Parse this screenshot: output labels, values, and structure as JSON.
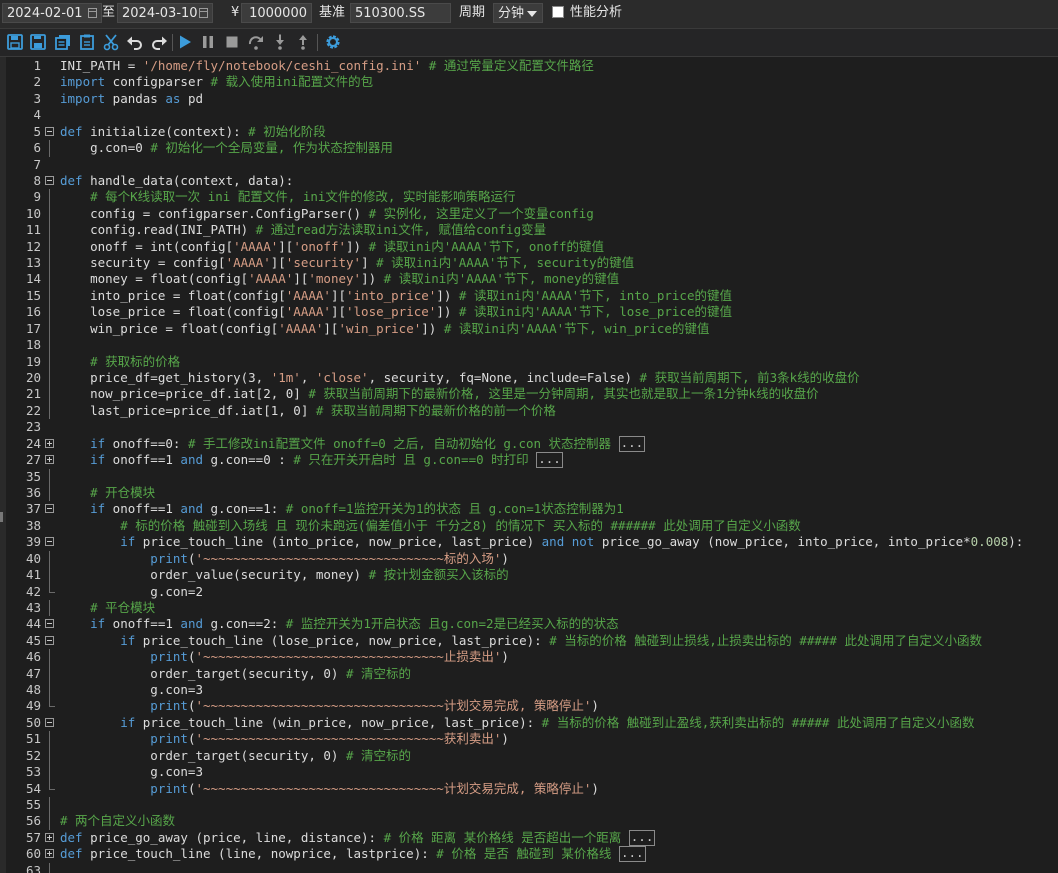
{
  "topbar": {
    "start_date": "2024-02-01",
    "to_label": "至",
    "end_date": "2024-03-10",
    "currency_symbol": "¥",
    "capital": "1000000",
    "benchmark_label": "基准",
    "benchmark": "510300.SS",
    "period_label": "周期",
    "period_value": "分钟",
    "perf_label": "性能分析",
    "perf_checked": false
  },
  "toolbar": {
    "buttons": [
      "save-icon",
      "save-as-icon",
      "copy-icon",
      "paste-icon",
      "cut-icon",
      "undo-icon",
      "redo-icon",
      "run-icon",
      "pause-icon",
      "stop-icon",
      "step-over-icon",
      "step-into-icon",
      "step-out-icon",
      "settings-icon"
    ],
    "accent_color": "#3c9cdb"
  },
  "editor": {
    "lines": [
      {
        "n": "1",
        "code": [
          [
            "",
            "INI_PATH = "
          ],
          [
            "str",
            "'/home/fly/notebook/ceshi_config.ini'"
          ],
          [
            "cm",
            " # 通过常量定义配置文件路径"
          ]
        ]
      },
      {
        "n": "2",
        "code": [
          [
            "kw",
            "import"
          ],
          [
            "",
            " configparser "
          ],
          [
            "cm",
            "# 载入使用ini配置文件的包"
          ]
        ]
      },
      {
        "n": "3",
        "code": [
          [
            "kw",
            "import"
          ],
          [
            "",
            " pandas "
          ],
          [
            "kw",
            "as"
          ],
          [
            "",
            " pd"
          ]
        ]
      },
      {
        "n": "4",
        "code": []
      },
      {
        "n": "5",
        "fold": "minus",
        "code": [
          [
            "kw",
            "def"
          ],
          [
            "",
            " initialize(context): "
          ],
          [
            "cm",
            "# 初始化阶段"
          ]
        ]
      },
      {
        "n": "6",
        "code": [
          [
            "",
            "    g.con=0 "
          ],
          [
            "cm",
            "# 初始化一个全局变量, 作为状态控制器用"
          ]
        ]
      },
      {
        "n": "7",
        "code": []
      },
      {
        "n": "8",
        "fold": "minus",
        "code": [
          [
            "kw",
            "def"
          ],
          [
            "",
            " handle_data(context, data):"
          ]
        ]
      },
      {
        "n": "9",
        "code": [
          [
            "cm",
            "    # 每个K线读取一次 ini 配置文件, ini文件的修改, 实时能影响策略运行"
          ]
        ]
      },
      {
        "n": "10",
        "code": [
          [
            "",
            "    config = configparser.ConfigParser() "
          ],
          [
            "cm",
            "# 实例化, 这里定义了一个变量config"
          ]
        ]
      },
      {
        "n": "11",
        "code": [
          [
            "",
            "    config.read(INI_PATH) "
          ],
          [
            "cm",
            "# 通过read方法读取ini文件, 赋值给config变量"
          ]
        ]
      },
      {
        "n": "12",
        "code": [
          [
            "",
            "    onoff = int(config["
          ],
          [
            "str",
            "'AAAA'"
          ],
          [
            "",
            "]["
          ],
          [
            "str",
            "'onoff'"
          ],
          [
            "",
            "]) "
          ],
          [
            "cm",
            "# 读取ini内'AAAA'节下, onoff的键值"
          ]
        ]
      },
      {
        "n": "13",
        "code": [
          [
            "",
            "    security = config["
          ],
          [
            "str",
            "'AAAA'"
          ],
          [
            "",
            "]["
          ],
          [
            "str",
            "'security'"
          ],
          [
            "",
            "] "
          ],
          [
            "cm",
            "# 读取ini内'AAAA'节下, security的键值"
          ]
        ]
      },
      {
        "n": "14",
        "code": [
          [
            "",
            "    money = float(config["
          ],
          [
            "str",
            "'AAAA'"
          ],
          [
            "",
            "]["
          ],
          [
            "str",
            "'money'"
          ],
          [
            "",
            "]) "
          ],
          [
            "cm",
            "# 读取ini内'AAAA'节下, money的键值"
          ]
        ]
      },
      {
        "n": "15",
        "code": [
          [
            "",
            "    into_price = float(config["
          ],
          [
            "str",
            "'AAAA'"
          ],
          [
            "",
            "]["
          ],
          [
            "str",
            "'into_price'"
          ],
          [
            "",
            "]) "
          ],
          [
            "cm",
            "# 读取ini内'AAAA'节下, into_price的键值"
          ]
        ]
      },
      {
        "n": "16",
        "code": [
          [
            "",
            "    lose_price = float(config["
          ],
          [
            "str",
            "'AAAA'"
          ],
          [
            "",
            "]["
          ],
          [
            "str",
            "'lose_price'"
          ],
          [
            "",
            "]) "
          ],
          [
            "cm",
            "# 读取ini内'AAAA'节下, lose_price的键值"
          ]
        ]
      },
      {
        "n": "17",
        "code": [
          [
            "",
            "    win_price = float(config["
          ],
          [
            "str",
            "'AAAA'"
          ],
          [
            "",
            "]["
          ],
          [
            "str",
            "'win_price'"
          ],
          [
            "",
            "]) "
          ],
          [
            "cm",
            "# 读取ini内'AAAA'节下, win_price的键值"
          ]
        ]
      },
      {
        "n": "18",
        "code": []
      },
      {
        "n": "19",
        "code": [
          [
            "cm",
            "    # 获取标的价格"
          ]
        ]
      },
      {
        "n": "20",
        "code": [
          [
            "",
            "    price_df=get_history(3, "
          ],
          [
            "str",
            "'1m'"
          ],
          [
            "",
            ", "
          ],
          [
            "str",
            "'close'"
          ],
          [
            "",
            ", security, fq=None, include=False) "
          ],
          [
            "cm",
            "# 获取当前周期下, 前3条k线的收盘价"
          ]
        ]
      },
      {
        "n": "21",
        "code": [
          [
            "",
            "    now_price=price_df.iat[2, 0] "
          ],
          [
            "cm",
            "# 获取当前周期下的最新价格, 这里是一分钟周期, 其实也就是取上一条1分钟k线的收盘价"
          ]
        ]
      },
      {
        "n": "22",
        "code": [
          [
            "",
            "    last_price=price_df.iat[1, 0] "
          ],
          [
            "cm",
            "# 获取当前周期下的最新价格的前一个价格"
          ]
        ]
      },
      {
        "n": "23",
        "code": []
      },
      {
        "n": "24",
        "fold": "plus",
        "code": [
          [
            "kw",
            "    if"
          ],
          [
            "",
            " onoff==0: "
          ],
          [
            "cm",
            "# 手工修改ini配置文件 onoff=0 之后, 自动初始化 g.con 状态控制器 "
          ],
          [
            "ell",
            "..."
          ]
        ]
      },
      {
        "n": "27",
        "fold": "plus",
        "code": [
          [
            "kw",
            "    if"
          ],
          [
            "",
            " onoff==1 "
          ],
          [
            "kw",
            "and"
          ],
          [
            "",
            " g.con==0 : "
          ],
          [
            "cm",
            "# 只在开关开启时 且 g.con==0 时打印 "
          ],
          [
            "ell",
            "..."
          ]
        ]
      },
      {
        "n": "35",
        "code": []
      },
      {
        "n": "36",
        "code": [
          [
            "cm",
            "    # 开仓模块"
          ]
        ]
      },
      {
        "n": "37",
        "fold": "minus",
        "code": [
          [
            "kw",
            "    if"
          ],
          [
            "",
            " onoff==1 "
          ],
          [
            "kw",
            "and"
          ],
          [
            "",
            " g.con==1: "
          ],
          [
            "cm",
            "# onoff=1监控开关为1的状态 且 g.con=1状态控制器为1"
          ]
        ]
      },
      {
        "n": "38",
        "code": [
          [
            "cm",
            "        # 标的价格 触碰到入场线 且 现价未跑远(偏差值小于 千分之8) 的情况下 买入标的 ###### 此处调用了自定义小函数"
          ]
        ]
      },
      {
        "n": "39",
        "fold": "minus",
        "code": [
          [
            "kw",
            "        if"
          ],
          [
            "",
            " price_touch_line (into_price, now_price, last_price) "
          ],
          [
            "kw",
            "and not"
          ],
          [
            "",
            " price_go_away (now_price, into_price, into_price*"
          ],
          [
            "nm",
            "0.008"
          ],
          [
            "",
            "):"
          ]
        ]
      },
      {
        "n": "40",
        "code": [
          [
            "kw",
            "            print"
          ],
          [
            "",
            "("
          ],
          [
            "str",
            "'~~~~~~~~~~~~~~~~~~~~~~~~~~~~~~~~标的入场'"
          ],
          [
            "",
            ")"
          ]
        ]
      },
      {
        "n": "41",
        "code": [
          [
            "",
            "            order_value(security, money) "
          ],
          [
            "cm",
            "# 按计划金额买入该标的"
          ]
        ]
      },
      {
        "n": "42",
        "end": true,
        "code": [
          [
            "",
            "            g.con=2"
          ]
        ]
      },
      {
        "n": "43",
        "code": [
          [
            "cm",
            "    # 平仓模块"
          ]
        ]
      },
      {
        "n": "44",
        "fold": "minus",
        "code": [
          [
            "kw",
            "    if"
          ],
          [
            "",
            " onoff==1 "
          ],
          [
            "kw",
            "and"
          ],
          [
            "",
            " g.con==2: "
          ],
          [
            "cm",
            "# 监控开关为1开启状态 且g.con=2是已经买入标的的状态"
          ]
        ]
      },
      {
        "n": "45",
        "fold": "minus",
        "code": [
          [
            "kw",
            "        if"
          ],
          [
            "",
            " price_touch_line (lose_price, now_price, last_price): "
          ],
          [
            "cm",
            "# 当标的价格 触碰到止损线,止损卖出标的 ##### 此处调用了自定义小函数"
          ]
        ]
      },
      {
        "n": "46",
        "code": [
          [
            "kw",
            "            print"
          ],
          [
            "",
            "("
          ],
          [
            "str",
            "'~~~~~~~~~~~~~~~~~~~~~~~~~~~~~~~~止损卖出'"
          ],
          [
            "",
            ")"
          ]
        ]
      },
      {
        "n": "47",
        "code": [
          [
            "",
            "            order_target(security, 0) "
          ],
          [
            "cm",
            "# 清空标的"
          ]
        ]
      },
      {
        "n": "48",
        "code": [
          [
            "",
            "            g.con=3"
          ]
        ]
      },
      {
        "n": "49",
        "end": true,
        "code": [
          [
            "kw",
            "            print"
          ],
          [
            "",
            "("
          ],
          [
            "str",
            "'~~~~~~~~~~~~~~~~~~~~~~~~~~~~~~~~计划交易完成, 策略停止'"
          ],
          [
            "",
            ")"
          ]
        ]
      },
      {
        "n": "50",
        "fold": "minus",
        "code": [
          [
            "kw",
            "        if"
          ],
          [
            "",
            " price_touch_line (win_price, now_price, last_price): "
          ],
          [
            "cm",
            "# 当标的价格 触碰到止盈线,获利卖出标的 ##### 此处调用了自定义小函数"
          ]
        ]
      },
      {
        "n": "51",
        "code": [
          [
            "kw",
            "            print"
          ],
          [
            "",
            "("
          ],
          [
            "str",
            "'~~~~~~~~~~~~~~~~~~~~~~~~~~~~~~~~获利卖出'"
          ],
          [
            "",
            ")"
          ]
        ]
      },
      {
        "n": "52",
        "code": [
          [
            "",
            "            order_target(security, 0) "
          ],
          [
            "cm",
            "# 清空标的"
          ]
        ]
      },
      {
        "n": "53",
        "code": [
          [
            "",
            "            g.con=3"
          ]
        ]
      },
      {
        "n": "54",
        "end": true,
        "code": [
          [
            "kw",
            "            print"
          ],
          [
            "",
            "("
          ],
          [
            "str",
            "'~~~~~~~~~~~~~~~~~~~~~~~~~~~~~~~~计划交易完成, 策略停止'"
          ],
          [
            "",
            ")"
          ]
        ]
      },
      {
        "n": "55",
        "code": []
      },
      {
        "n": "56",
        "code": [
          [
            "cm",
            "# 两个自定义小函数"
          ]
        ]
      },
      {
        "n": "57",
        "fold": "plus",
        "code": [
          [
            "kw",
            "def"
          ],
          [
            "",
            " price_go_away (price, line, distance): "
          ],
          [
            "cm",
            "# 价格 距离 某价格线 是否超出一个距离 "
          ],
          [
            "ell",
            "..."
          ]
        ]
      },
      {
        "n": "60",
        "fold": "plus",
        "code": [
          [
            "kw",
            "def"
          ],
          [
            "",
            " price_touch_line (line, nowprice, lastprice): "
          ],
          [
            "cm",
            "# 价格 是否 触碰到 某价格线 "
          ],
          [
            "ell",
            "..."
          ]
        ]
      },
      {
        "n": "63",
        "code": []
      }
    ]
  }
}
